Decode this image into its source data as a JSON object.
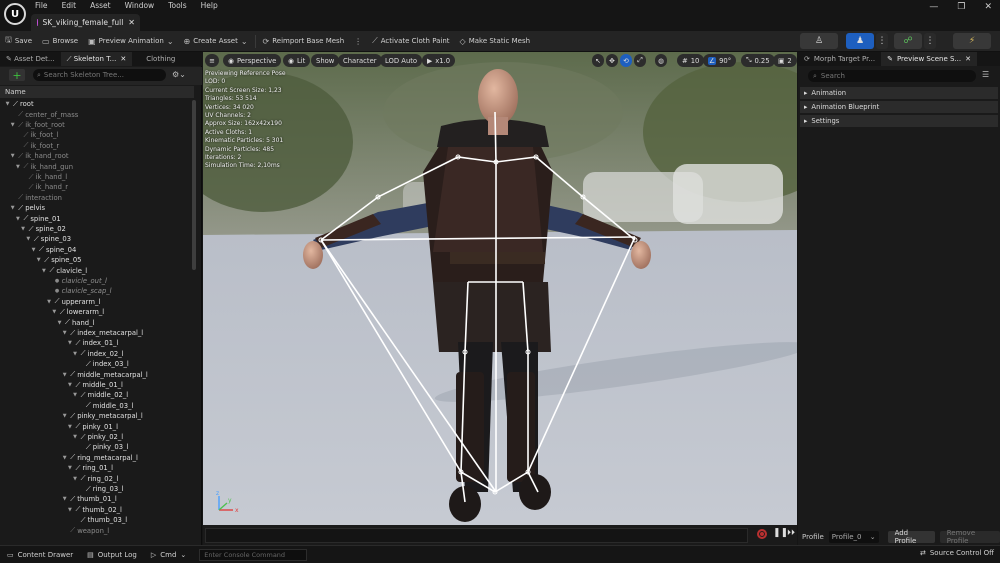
{
  "app": {
    "logo_text": "U"
  },
  "menu": [
    "File",
    "Edit",
    "Asset",
    "Window",
    "Tools",
    "Help"
  ],
  "doc_tab": {
    "label": "SK_viking_female_full",
    "close": "✕"
  },
  "window_controls": {
    "minimize": "—",
    "restore": "❐",
    "close": "✕"
  },
  "toolbar": {
    "save": "Save",
    "browse": "Browse",
    "preview_animation": "Preview Animation",
    "create_asset": "Create Asset",
    "reimport": "Reimport Base Mesh",
    "cloth_paint": "Activate Cloth Paint",
    "make_static": "Make Static Mesh"
  },
  "left_panel": {
    "tabs": [
      "Asset Det...",
      "Skeleton T...",
      "Clothing"
    ],
    "tab_close": "✕",
    "search_placeholder": "Search Skeleton Tree...",
    "add": "+",
    "name_header": "Name",
    "tree": [
      {
        "label": "root",
        "level": 0,
        "kind": "bone",
        "expanded": true
      },
      {
        "label": "center_of_mass",
        "level": 1,
        "kind": "virtual"
      },
      {
        "label": "ik_foot_root",
        "level": 1,
        "kind": "virtual",
        "expanded": true
      },
      {
        "label": "ik_foot_l",
        "level": 2,
        "kind": "virtual"
      },
      {
        "label": "ik_foot_r",
        "level": 2,
        "kind": "virtual"
      },
      {
        "label": "ik_hand_root",
        "level": 1,
        "kind": "virtual",
        "expanded": true
      },
      {
        "label": "ik_hand_gun",
        "level": 2,
        "kind": "virtual",
        "expanded": true
      },
      {
        "label": "ik_hand_l",
        "level": 3,
        "kind": "virtual"
      },
      {
        "label": "ik_hand_r",
        "level": 3,
        "kind": "virtual"
      },
      {
        "label": "interaction",
        "level": 1,
        "kind": "virtual"
      },
      {
        "label": "pelvis",
        "level": 1,
        "kind": "bone",
        "expanded": true
      },
      {
        "label": "spine_01",
        "level": 2,
        "kind": "bone",
        "expanded": true
      },
      {
        "label": "spine_02",
        "level": 3,
        "kind": "bone",
        "expanded": true
      },
      {
        "label": "spine_03",
        "level": 4,
        "kind": "bone",
        "expanded": true
      },
      {
        "label": "spine_04",
        "level": 5,
        "kind": "bone",
        "expanded": true
      },
      {
        "label": "spine_05",
        "level": 6,
        "kind": "bone",
        "expanded": true
      },
      {
        "label": "clavicle_l",
        "level": 7,
        "kind": "bone",
        "expanded": true
      },
      {
        "label": "clavicle_out_l",
        "level": 8,
        "kind": "socket"
      },
      {
        "label": "clavicle_scap_l",
        "level": 8,
        "kind": "socket"
      },
      {
        "label": "upperarm_l",
        "level": 8,
        "kind": "bone",
        "expanded": true
      },
      {
        "label": "lowerarm_l",
        "level": 9,
        "kind": "bone",
        "expanded": true
      },
      {
        "label": "hand_l",
        "level": 10,
        "kind": "bone",
        "expanded": true
      },
      {
        "label": "index_metacarpal_l",
        "level": 11,
        "kind": "bone",
        "expanded": true
      },
      {
        "label": "index_01_l",
        "level": 12,
        "kind": "bone",
        "expanded": true
      },
      {
        "label": "index_02_l",
        "level": 13,
        "kind": "bone",
        "expanded": true
      },
      {
        "label": "index_03_l",
        "level": 14,
        "kind": "bone"
      },
      {
        "label": "middle_metacarpal_l",
        "level": 11,
        "kind": "bone",
        "expanded": true
      },
      {
        "label": "middle_01_l",
        "level": 12,
        "kind": "bone",
        "expanded": true
      },
      {
        "label": "middle_02_l",
        "level": 13,
        "kind": "bone",
        "expanded": true
      },
      {
        "label": "middle_03_l",
        "level": 14,
        "kind": "bone"
      },
      {
        "label": "pinky_metacarpal_l",
        "level": 11,
        "kind": "bone",
        "expanded": true
      },
      {
        "label": "pinky_01_l",
        "level": 12,
        "kind": "bone",
        "expanded": true
      },
      {
        "label": "pinky_02_l",
        "level": 13,
        "kind": "bone",
        "expanded": true
      },
      {
        "label": "pinky_03_l",
        "level": 14,
        "kind": "bone"
      },
      {
        "label": "ring_metacarpal_l",
        "level": 11,
        "kind": "bone",
        "expanded": true
      },
      {
        "label": "ring_01_l",
        "level": 12,
        "kind": "bone",
        "expanded": true
      },
      {
        "label": "ring_02_l",
        "level": 13,
        "kind": "bone",
        "expanded": true
      },
      {
        "label": "ring_03_l",
        "level": 14,
        "kind": "bone"
      },
      {
        "label": "thumb_01_l",
        "level": 11,
        "kind": "bone",
        "expanded": true
      },
      {
        "label": "thumb_02_l",
        "level": 12,
        "kind": "bone",
        "expanded": true
      },
      {
        "label": "thumb_03_l",
        "level": 13,
        "kind": "bone"
      },
      {
        "label": "weapon_l",
        "level": 11,
        "kind": "virtual"
      }
    ]
  },
  "viewport": {
    "perspective": "Perspective",
    "lit": "Lit",
    "show": "Show",
    "character": "Character",
    "lod": "LOD Auto",
    "speed": "x1.0",
    "grid_snap": "10",
    "rot_snap": "90°",
    "scale_snap": "0.25",
    "cam_speed": "2",
    "stats": [
      "Previewing Reference Pose",
      "LOD: 0",
      "Current Screen Size: 1,23",
      "Triangles: 53 514",
      "Vertices: 34 020",
      "UV Channels: 2",
      "Approx Size: 162x42x190",
      "Active Cloths: 1",
      "Kinematic Particles: 5 301",
      "Dynamic Particles: 485",
      "Iterations: 2",
      "Simulation Time: 2,10ms"
    ],
    "axis": {
      "x": "x",
      "y": "y",
      "z": "z"
    }
  },
  "right_panel": {
    "tabs": [
      "Morph Target Pr...",
      "Preview Scene S..."
    ],
    "search_placeholder": "Search",
    "sections": [
      "Animation",
      "Animation Blueprint",
      "Settings"
    ],
    "profile_label": "Profile",
    "profile_value": "Profile_0",
    "add_profile": "Add Profile",
    "remove_profile": "Remove Profile"
  },
  "status": {
    "content_drawer": "Content Drawer",
    "output_log": "Output Log",
    "cmd": "Cmd",
    "console_placeholder": "Enter Console Command",
    "source_control": "Source Control Off"
  },
  "colors": {
    "accent_blue": "#1e5fbf",
    "bone_white": "#ffffff",
    "tab_pink": "#c34fd6"
  }
}
